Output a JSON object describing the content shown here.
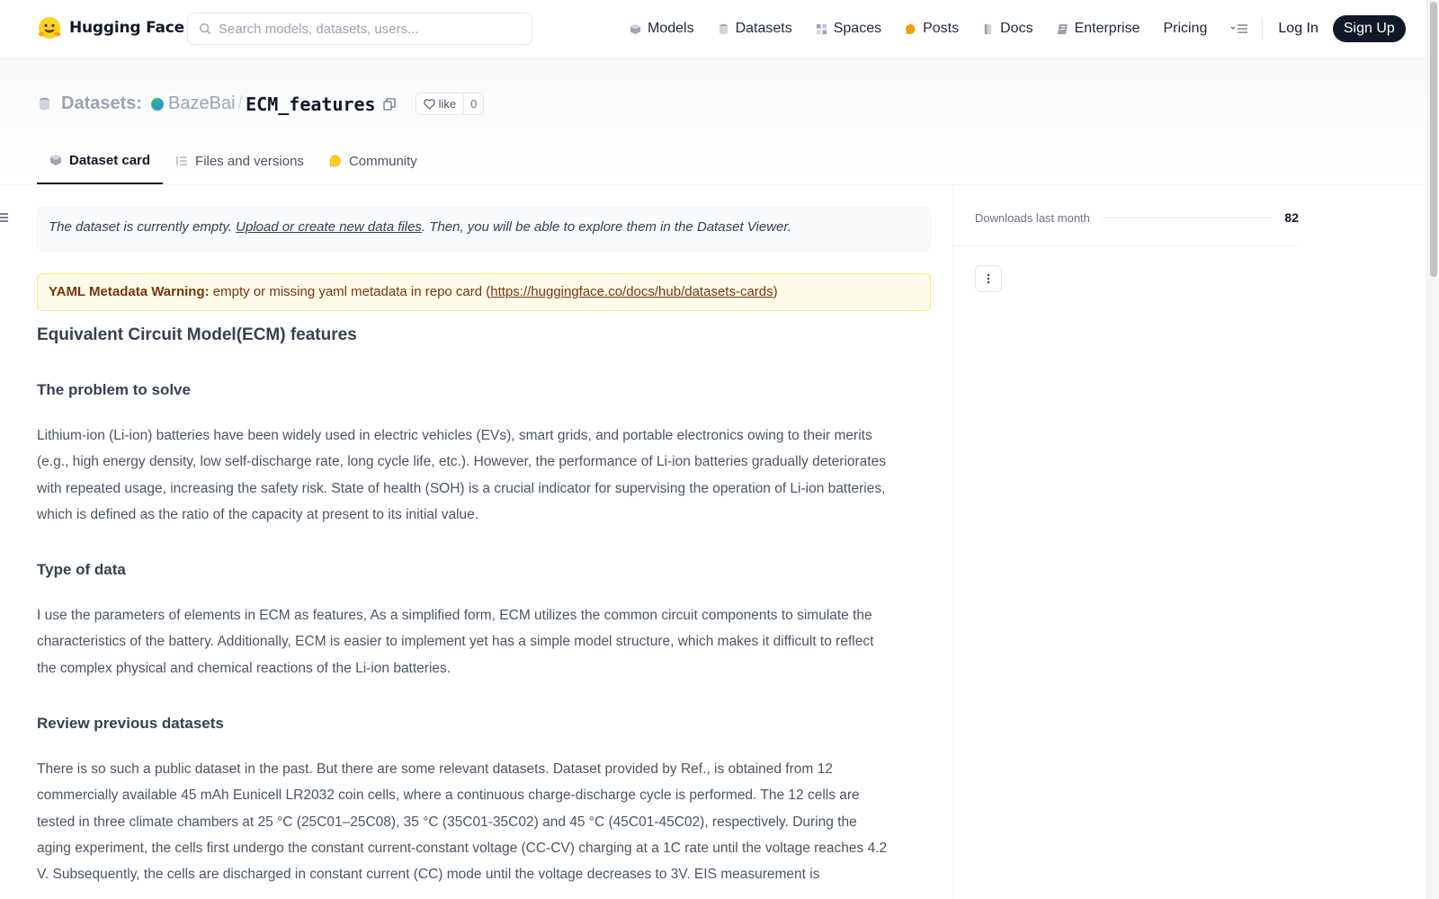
{
  "brand": {
    "name": "Hugging Face",
    "logo_icon": "hugging-face-logo"
  },
  "search": {
    "placeholder": "Search models, datasets, users..."
  },
  "nav": {
    "items": [
      {
        "label": "Models",
        "icon": "cube-icon"
      },
      {
        "label": "Datasets",
        "icon": "database-icon"
      },
      {
        "label": "Spaces",
        "icon": "grid-icon"
      },
      {
        "label": "Posts",
        "icon": "chat-bubble-icon"
      },
      {
        "label": "Docs",
        "icon": "book-icon"
      },
      {
        "label": "Enterprise",
        "icon": "enterprise-icon"
      },
      {
        "label": "Pricing",
        "icon": ""
      }
    ],
    "login": "Log In",
    "signup": "Sign Up"
  },
  "repo": {
    "type_label": "Datasets:",
    "owner": "BazeBai",
    "name": "ECM_features",
    "like_label": "like",
    "like_count": "0"
  },
  "tabs": [
    {
      "label": "Dataset card",
      "active": true
    },
    {
      "label": "Files and versions",
      "active": false
    },
    {
      "label": "Community",
      "active": false
    }
  ],
  "empty_note": {
    "prefix": "The dataset is currently empty. ",
    "link": "Upload or create new data files",
    "suffix": ". Then, you will be able to explore them in the Dataset Viewer."
  },
  "yaml_warning": {
    "title": "YAML Metadata Warning:",
    "text": " empty or missing yaml metadata in repo card (",
    "link": "https://huggingface.co/docs/hub/datasets-cards",
    "suffix": ")"
  },
  "card": {
    "h1": "Equivalent Circuit Model(ECM) features",
    "sections": [
      {
        "heading": "The problem to solve",
        "text": "Lithium-ion (Li-ion) batteries have been widely used in electric vehicles (EVs), smart grids, and portable electronics owing to their merits (e.g., high energy density, low self-discharge rate, long cycle life, etc.). However, the performance of Li-ion batteries gradually deteriorates with repeated usage, increasing the safety risk. State of health (SOH) is a crucial indicator for supervising the operation of Li-ion batteries, which is defined as the ratio of the capacity at present to its initial value."
      },
      {
        "heading": "Type of data",
        "text": "I use the parameters of elements in ECM as features, As a simplified form, ECM utilizes the common circuit components to simulate the characteristics of the battery. Additionally, ECM is easier to implement yet has a simple model structure, which makes it difficult to reflect the complex physical and chemical reactions of the Li-ion batteries."
      },
      {
        "heading": "Review previous datasets",
        "text": "There is so such a public dataset in the past. But there are some relevant datasets. Dataset provided by Ref., is obtained from 12 commercially available 45 mAh Eunicell LR2032 coin cells, where a continuous charge-discharge cycle is performed. The 12 cells are tested in three climate chambers at 25 °C (25C01–25C08), 35 °C (35C01-35C02) and 45 °C (45C01-45C02), respectively. During the aging experiment, the cells first undergo the constant current-constant voltage (CC-CV) charging at a 1C rate until the voltage reaches 4.2 V. Subsequently, the cells are discharged in constant current (CC) mode until the voltage decreases to 3V. EIS measurement is"
      }
    ]
  },
  "sidebar": {
    "downloads_label": "Downloads last month",
    "downloads_value": "82"
  }
}
